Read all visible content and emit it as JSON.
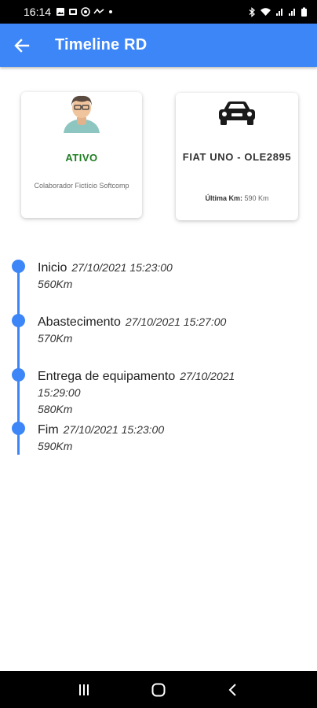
{
  "status_bar": {
    "time": "16:14",
    "notification_icons": [
      "gallery-icon",
      "photo-icon",
      "whatsapp-icon",
      "nfc-icon",
      "dot-icon"
    ],
    "system_icons": [
      "bluetooth-icon",
      "wifi-icon",
      "signal-icon",
      "signal-icon",
      "battery-icon"
    ]
  },
  "app_bar": {
    "title": "Timeline RD",
    "back_icon": "arrow-left-icon",
    "color": "#3d86f7"
  },
  "collaborator_card": {
    "status": "ATIVO",
    "status_color": "#1e7d22",
    "name": "Colaborador Fictício Softcomp",
    "avatar_icon": "user-avatar-icon"
  },
  "vehicle_card": {
    "vehicle": "FIAT UNO - OLE2895",
    "last_km_label": "Última Km:",
    "last_km_value": "590 Km",
    "car_icon": "car-icon"
  },
  "timeline": {
    "line_color": "#3d86f7",
    "items": [
      {
        "title": "Inicio",
        "datetime": "27/10/2021 15:23:00",
        "km": "560Km"
      },
      {
        "title": "Abastecimento",
        "datetime": "27/10/2021 15:27:00",
        "km": "570Km"
      },
      {
        "title": "Entrega de equipamento",
        "datetime": "27/10/2021 15:29:00",
        "km": "580Km"
      },
      {
        "title": "Fim",
        "datetime": "27/10/2021 15:23:00",
        "km": "590Km"
      }
    ]
  },
  "nav_bar": {
    "buttons": [
      "recents-icon",
      "home-icon",
      "back-icon"
    ]
  }
}
